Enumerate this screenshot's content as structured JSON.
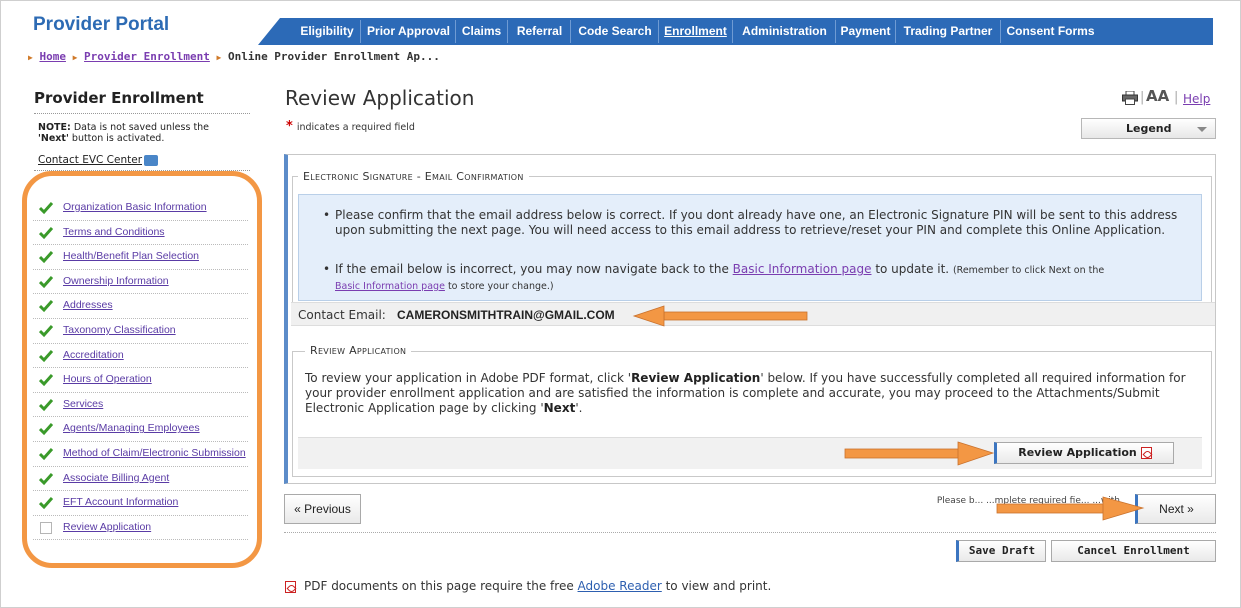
{
  "header": {
    "portal_title": "Provider Portal",
    "nav": [
      "Eligibility",
      "Prior Approval",
      "Claims",
      "Referral",
      "Code Search",
      "Enrollment",
      "Administration",
      "Payment",
      "Trading Partner",
      "Consent Forms"
    ],
    "active_nav": "Enrollment"
  },
  "breadcrumb": {
    "home": "Home",
    "provider_enrollment": "Provider Enrollment",
    "current": "Online Provider Enrollment Ap..."
  },
  "sidebar": {
    "title": "Provider Enrollment",
    "note_bold": "NOTE:",
    "note_text": " Data is not saved unless the",
    "note_next": "'Next'",
    "note_text2": " button is activated.",
    "contact": "Contact EVC Center",
    "steps": [
      {
        "label": "Organization Basic Information",
        "done": true
      },
      {
        "label": "Terms and Conditions",
        "done": true
      },
      {
        "label": "Health/Benefit Plan Selection",
        "done": true
      },
      {
        "label": "Ownership Information",
        "done": true
      },
      {
        "label": "Addresses",
        "done": true
      },
      {
        "label": "Taxonomy Classification",
        "done": true
      },
      {
        "label": "Accreditation",
        "done": true
      },
      {
        "label": "Hours of Operation",
        "done": true
      },
      {
        "label": "Services",
        "done": true
      },
      {
        "label": "Agents/Managing Employees",
        "done": true
      },
      {
        "label": "Method of Claim/Electronic Submission",
        "done": true
      },
      {
        "label": "Associate Billing Agent",
        "done": true
      },
      {
        "label": "EFT Account Information",
        "done": true
      },
      {
        "label": "Review Application",
        "done": false
      }
    ]
  },
  "main": {
    "title": "Review Application",
    "req_star": "*",
    "req_note": "indicates a required field",
    "aa": "AA",
    "help": "Help",
    "legend": "Legend",
    "esig_legend": "Electronic Signature - Email Confirmation",
    "bullet1": "Please confirm that the email address below is correct. If you dont already have one, an Electronic Signature PIN will be sent to this address upon submitting the next page. You will need access to this email address to retrieve/reset your PIN and complete this Online Application.",
    "bullet2_pre": "If the email below is incorrect, you may now navigate back to the ",
    "bullet2_link": "Basic Information page",
    "bullet2_post": " to update it. ",
    "bullet2_small_pre": "(Remember to click Next on the ",
    "bullet2_small_link": "Basic Information page",
    "bullet2_small_post": " to store your change.)",
    "contact_label": "Contact Email:",
    "contact_email": "CAMERONSMITHTRAIN@GMAIL.COM",
    "review_legend": "Review Application",
    "review_text_1": "To review your application in Adobe PDF format, click '",
    "review_text_bold": "Review Application",
    "review_text_2": "' below. If you have successfully completed all required information for your provider enrollment application and are satisfied the information is complete and accurate, you may proceed to the Attachments/Submit Electronic Application page by clicking '",
    "review_text_next": "Next",
    "review_text_3": "'.",
    "review_button": "Review Application",
    "previous_button": "« Previous",
    "please_text": "Please b... ...mplete required fie... ...with valid conte...",
    "next_button": "Next »",
    "save_draft": "Save Draft",
    "cancel_enrollment": "Cancel Enrollment",
    "pdf_note_pre": "PDF documents on this page require the free ",
    "pdf_note_link": "Adobe Reader",
    "pdf_note_post": " to view and print."
  },
  "colors": {
    "nav_blue": "#2c6ab7",
    "annotation_orange": "#f39744",
    "link_purple": "#7a3db0",
    "check_green": "#3a9a2a"
  }
}
